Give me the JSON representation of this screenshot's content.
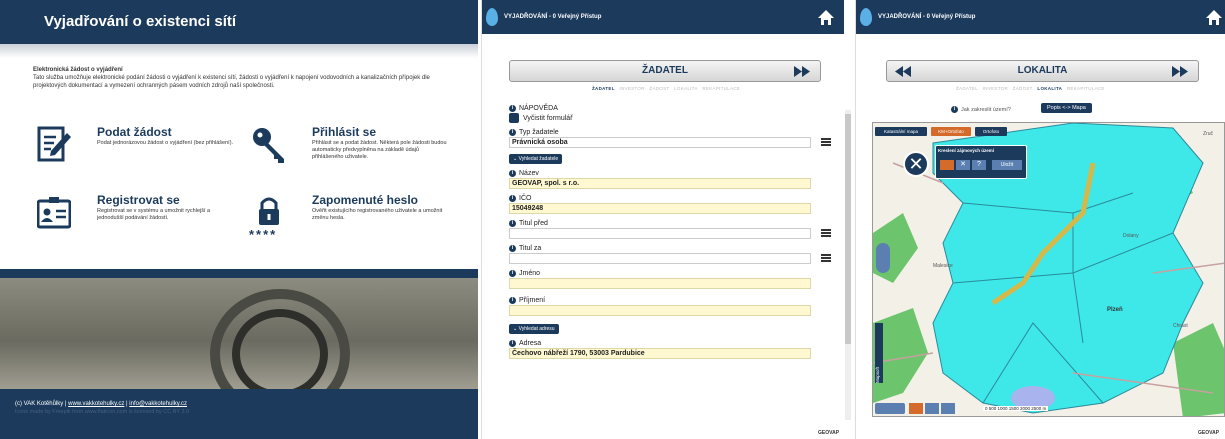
{
  "portal": {
    "title": "Vyjadřování o existenci sítí",
    "intro_heading": "Elektronická žádost o vyjádření",
    "intro_text": "Tato služba umožňuje elektronické podání žádosti o vyjádření k existenci sítí, žádosti o vyjádření k napojení vodovodních a kanalizačních přípojek dle projektových dokumentací a vymezení ochranných pásem vodních zdrojů naší společnosti.",
    "tiles": [
      {
        "title": "Podat žádost",
        "text": "Podat jednorázovou žádost o vyjádření (bez přihlášení).",
        "icon": "edit-document-icon"
      },
      {
        "title": "Přihlásit se",
        "text": "Přihlásit se a podat žádost. Některá pole žádosti budou automaticky předvyplněna na základě údajů přihlášeného uživatele.",
        "icon": "key-icon"
      },
      {
        "title": "Registrovat se",
        "text": "Registrovat se v systému a umožnit rychlejší a jednodušší podávání žádostí.",
        "icon": "id-card-icon"
      },
      {
        "title": "Zapomenuté heslo",
        "text": "Ověřit existujícího registrovaného uživatele a umožnit změnu hesla.",
        "icon": "padlock-icon",
        "mask": "****"
      }
    ],
    "footer_main": "(c) VAK Kotěhůlky | ",
    "footer_link1": "www.vakkotehulky.cz",
    "footer_sep": " | ",
    "footer_link2": "info@vakkotehulky.cz",
    "footer_small": "Icons made by Freepik from www.flaticon.com is licensed by CC BY 3.0"
  },
  "form_screen": {
    "topbar": "VYJADŘOVÁNÍ - 0 Veřejný Přístup",
    "step_title": "ŽADATEL",
    "next_icon": "double-chevron-right-icon",
    "steps": [
      "ŽADATEL",
      "INVESTOR",
      "ŽÁDOST",
      "LOKALITA",
      "REKAPITULACE"
    ],
    "help": "NÁPOVĚDA",
    "clear": "Vyčistit formulář",
    "fields": {
      "typ_label": "Typ žadatele",
      "typ_value": "Právnická osoba",
      "search_applicant": "Vyhledat žadatele",
      "nazev_label": "Název",
      "nazev_value": "GEOVAP, spol. s r.o.",
      "ico_label": "IČO",
      "ico_value": "15049248",
      "titul_pred_label": "Titul před",
      "titul_pred_value": "",
      "titul_za_label": "Titul za",
      "titul_za_value": "",
      "jmeno_label": "Jméno",
      "jmeno_value": "",
      "prijmeni_label": "Příjmení",
      "prijmeni_value": "",
      "search_address": "Vyhledat adresu",
      "adresa_label": "Adresa",
      "adresa_value": "Čechovo nábřeží 1790, 53003 Pardubice"
    },
    "brand": "GEOVAP"
  },
  "map_screen": {
    "topbar": "VYJADŘOVÁNÍ - 0 Veřejný Přístup",
    "step_title": "LOKALITA",
    "steps": [
      "ŽADATEL",
      "INVESTOR",
      "ŽÁDOST",
      "LOKALITA",
      "REKAPITULACE"
    ],
    "help_link": "Jak zakreslit území?",
    "toggle_button": "Popis <-> Mapa",
    "map_tools": [
      "Katastrální mapa",
      "KM+Ortofoto",
      "Ortofoto"
    ],
    "draw_panel_title": "Kreslení zájmových území",
    "draw_done": "Uložit",
    "place_labels": [
      "Plzeň",
      "Zruč",
      "Malesice",
      "Dolany",
      "Chrást"
    ],
    "scale_text": "0  500  1000 1500  2000 2500 m",
    "brand": "GEOVAP",
    "colors": {
      "area": "#3fe8e8",
      "forest": "#6cc46c",
      "route": "#d4b84a",
      "navy": "#1b3a5c"
    }
  }
}
